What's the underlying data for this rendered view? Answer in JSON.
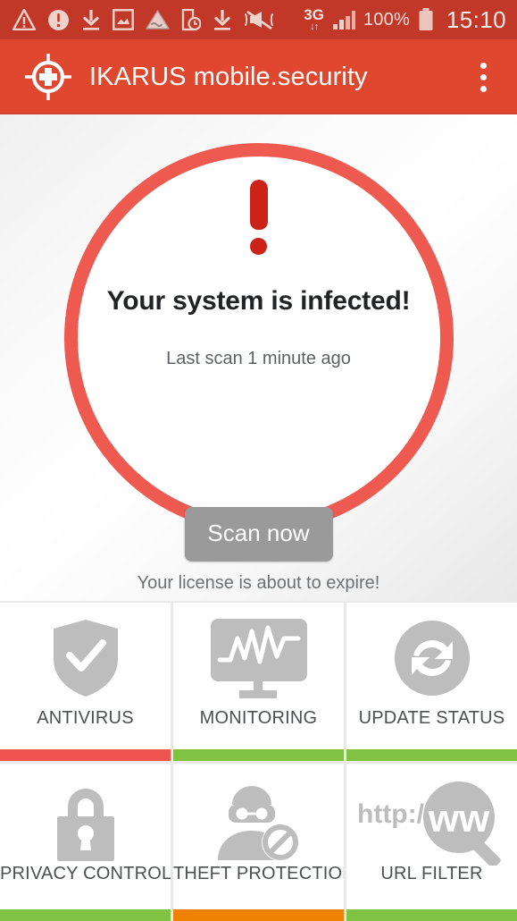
{
  "status_bar": {
    "icons": [
      "warning-triangle-icon",
      "error-circle-icon",
      "download-icon",
      "image-icon",
      "triangle-alert-icon",
      "phone-clock-icon",
      "download-icon-2",
      "vibrate-off-icon"
    ],
    "network_label": "3G",
    "battery_percent": "100%",
    "clock": "15:10"
  },
  "app_bar": {
    "logo": "ikarus-crosshair-logo",
    "title": "IKARUS mobile.security",
    "overflow": "overflow-menu-icon"
  },
  "hero": {
    "alert_icon": "exclamation-mark-icon",
    "title": "Your system is infected!",
    "subtitle": "Last scan 1 minute ago",
    "scan_button": "Scan now",
    "license_warning": "Your license is about to expire!",
    "ring_color": "#ee5950",
    "alert_color": "#cc2318"
  },
  "tiles": [
    {
      "label": "ANTIVIRUS",
      "icon": "shield-check-icon",
      "status_color": "#ef5350"
    },
    {
      "label": "MONITORING",
      "icon": "monitor-graph-icon",
      "status_color": "#80c342"
    },
    {
      "label": "UPDATE STATUS",
      "icon": "sync-refresh-icon",
      "status_color": "#80c342"
    },
    {
      "label": "PRIVACY CONTROL",
      "icon": "padlock-icon",
      "status_color": "#80c342"
    },
    {
      "label": "THEFT PROTECTION",
      "icon": "burglar-blocked-icon",
      "status_color": "#ef8100"
    },
    {
      "label": "URL FILTER",
      "icon": "url-magnifier-icon",
      "status_color": "#80c342"
    }
  ],
  "url_filter_icon": {
    "prefix": "http://w",
    "magnified": "ww"
  },
  "colors": {
    "status_bar_bg": "#c13829",
    "app_bar_bg": "#e0472f",
    "icon_gray": "#bdbdbd",
    "button_gray": "#9a9a9a"
  }
}
